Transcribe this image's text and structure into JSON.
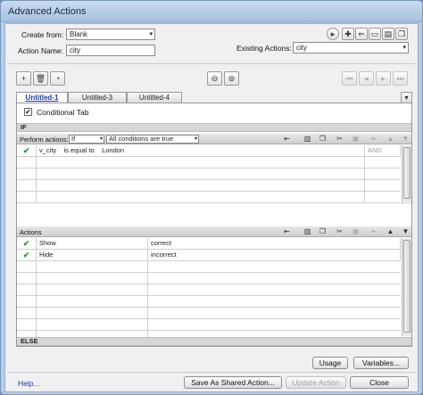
{
  "window": {
    "title": "Advanced Actions"
  },
  "form": {
    "create_from_label": "Create from:",
    "create_from_value": "Blank",
    "action_name_label": "Action Name:",
    "action_name_value": "city",
    "existing_actions_label": "Existing Actions:",
    "existing_actions_value": "city"
  },
  "tabs": [
    {
      "label": "Untitled-1",
      "active": true
    },
    {
      "label": "Untitled-3",
      "active": false
    },
    {
      "label": "Untitled-4",
      "active": false
    }
  ],
  "conditional": {
    "label": "Conditional Tab",
    "checked": true,
    "check_mark": "✔"
  },
  "if_section": {
    "label": "IF",
    "perform_actions_label": "Perform actions:",
    "perform_actions_value": "If",
    "conditions_value": "All conditions are true",
    "rows": [
      {
        "enabled": true,
        "variable": "v_city",
        "operator": "is equal to",
        "value": "London",
        "logic": "AND"
      }
    ]
  },
  "actions_section": {
    "label": "Actions",
    "rows": [
      {
        "enabled": true,
        "action": "Show",
        "target": "correct"
      },
      {
        "enabled": true,
        "action": "Hide",
        "target": "incorrect"
      }
    ]
  },
  "else_section": {
    "label": "ELSE"
  },
  "buttons": {
    "usage": "Usage",
    "variables": "Variables...",
    "help": "Help...",
    "save_shared": "Save As Shared Action...",
    "update_action": "Update Action",
    "close": "Close"
  },
  "glyphs": {
    "check": "✔",
    "arrow": "▾"
  }
}
